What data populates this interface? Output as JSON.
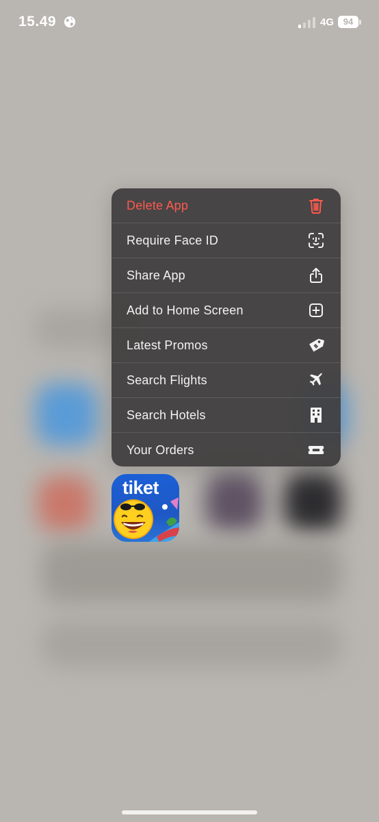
{
  "status_bar": {
    "time": "15.49",
    "network": "4G",
    "battery": "94"
  },
  "context_menu": {
    "items": [
      {
        "label": "Delete App",
        "icon": "trash-icon",
        "destructive": true
      },
      {
        "label": "Require Face ID",
        "icon": "face-id-icon",
        "destructive": false
      },
      {
        "label": "Share App",
        "icon": "share-icon",
        "destructive": false
      },
      {
        "label": "Add to Home Screen",
        "icon": "plus-square-icon",
        "destructive": false
      },
      {
        "label": "Latest Promos",
        "icon": "tag-icon",
        "destructive": false
      },
      {
        "label": "Search Flights",
        "icon": "airplane-icon",
        "destructive": false
      },
      {
        "label": "Search Hotels",
        "icon": "building-icon",
        "destructive": false
      },
      {
        "label": "Your Orders",
        "icon": "ticket-icon",
        "destructive": false
      }
    ]
  },
  "app_icon": {
    "name": "tiket"
  },
  "colors": {
    "destructive": "#ff5a4e",
    "menu_background": "#3e3c3c",
    "app_icon_blue": "#1b5fd6"
  }
}
